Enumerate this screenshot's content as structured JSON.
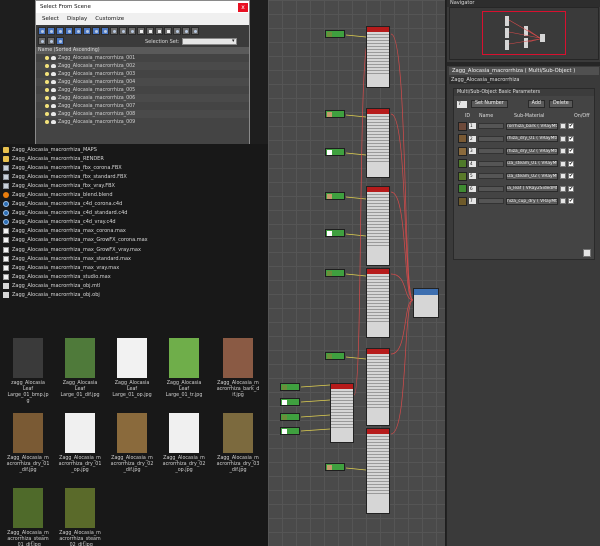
{
  "select_from_scene": {
    "title": "Select From Scene",
    "close_glyph": "x",
    "menus": [
      "Select",
      "Display",
      "Customize"
    ],
    "selection_set_label": "Selection Set:",
    "selection_set_value": "",
    "list_header": "Name (Sorted Ascending)",
    "objects": [
      "Zagg_Alocasia_macrorrhiza_001",
      "Zagg_Alocasia_macrorrhiza_002",
      "Zagg_Alocasia_macrorrhiza_003",
      "Zagg_Alocasia_macrorrhiza_004",
      "Zagg_Alocasia_macrorrhiza_005",
      "Zagg_Alocasia_macrorrhiza_006",
      "Zagg_Alocasia_macrorrhiza_007",
      "Zagg_Alocasia_macrorrhiza_008",
      "Zagg_Alocasia_macrorrhiza_009"
    ]
  },
  "files": [
    {
      "name": "Zagg_Alocasia_macrorrhiza_MAPS",
      "icon": "folder"
    },
    {
      "name": "Zagg_Alocasia_macrorrhiza_RENDER",
      "icon": "folder"
    },
    {
      "name": "Zagg_Alocasia_macrorrhiza_fbx_corona.FBX",
      "icon": "fbx"
    },
    {
      "name": "Zagg_Alocasia_macrorrhiza_fbx_standard.FBX",
      "icon": "fbx"
    },
    {
      "name": "Zagg_Alocasia_macrorrhiza_fbx_vray.FBX",
      "icon": "fbx"
    },
    {
      "name": "Zagg_Alocasia_macrorrhiza_blend.blend",
      "icon": "blend"
    },
    {
      "name": "Zagg_Alocasia_macrorrhiza_c4d_corona.c4d",
      "icon": "cfile"
    },
    {
      "name": "Zagg_Alocasia_macrorrhiza_c4d_standard.c4d",
      "icon": "cfile"
    },
    {
      "name": "Zagg_Alocasia_macrorrhiza_c4d_vray.c4d",
      "icon": "cfile"
    },
    {
      "name": "Zagg_Alocasia_macrorrhiza_max_corona.max",
      "icon": "max"
    },
    {
      "name": "Zagg_Alocasia_macrorrhiza_max_GrowFX_corona.max",
      "icon": "max"
    },
    {
      "name": "Zagg_Alocasia_macrorrhiza_max_GrowFX_vray.max",
      "icon": "max"
    },
    {
      "name": "Zagg_Alocasia_macrorrhiza_max_standard.max",
      "icon": "max"
    },
    {
      "name": "Zagg_Alocasia_macrorrhiza_max_vray.max",
      "icon": "max"
    },
    {
      "name": "Zagg_Alocasia_macrorrhiza_studio.max",
      "icon": "max"
    },
    {
      "name": "Zagg_Alocasia_macrorrhiza_obj.mtl",
      "icon": "mtl"
    },
    {
      "name": "Zagg_Alocasia_macrorrhiza_obj.obj",
      "icon": "mtl"
    }
  ],
  "thumbnails": [
    {
      "lines": [
        "zagg_Alocasia",
        "Leaf",
        "Large_01_bmp.jp",
        "g"
      ],
      "color": "#3a3a3a"
    },
    {
      "lines": [
        "Zagg_Alocasia",
        "Leaf",
        "Large_01_dif.jpg"
      ],
      "color": "#4f7a3a"
    },
    {
      "lines": [
        "Zagg_Alocasia",
        "Leaf",
        "Large_01_op.jpg"
      ],
      "color": "#f2f2f2"
    },
    {
      "lines": [
        "Zagg_Alocasia",
        "Leaf",
        "Large_01_tr.jpg"
      ],
      "color": "#6fae4a"
    },
    {
      "lines": [
        "Zagg_Alocasia_m",
        "acrorrhiza_bark_d",
        "if.jpg"
      ],
      "color": "#8a5a44"
    },
    {
      "lines": [
        "Zagg_Alocasia_m",
        "acrorrhiza_dry_01",
        "_dif.jpg"
      ],
      "color": "#7a5a34"
    },
    {
      "lines": [
        "Zagg_Alocasia_m",
        "acrorrhiza_dry_01",
        "_op.jpg"
      ],
      "color": "#f0f0f0"
    },
    {
      "lines": [
        "Zagg_Alocasia_m",
        "acrorrhiza_dry_02",
        "_dif.jpg"
      ],
      "color": "#8a6a3c"
    },
    {
      "lines": [
        "Zagg_Alocasia_m",
        "acrorrhiza_dry_02",
        "_op.jpg"
      ],
      "color": "#f0f0f0"
    },
    {
      "lines": [
        "Zagg_Alocasia_m",
        "acrorrhiza_dry_03",
        "_dif.jpg"
      ],
      "color": "#7c6a3e"
    },
    {
      "lines": [
        "Zagg_Alocasia_m",
        "acrorrhiza_steam",
        "_01_dif.jpg"
      ],
      "color": "#4f6a2a"
    },
    {
      "lines": [
        "Zagg_Alocasia_m",
        "acrorrhiza_steam",
        "_02_dif.jpg"
      ],
      "color": "#5a6a2a"
    }
  ],
  "navigator": {
    "title": "Navigator"
  },
  "material": {
    "title": "Zagg_Alocasia_macrorrhiza  ( Multi/Sub-Object )",
    "name": "Zagg_Alocasia_macrorrhiza",
    "rollout_title": "Multi/Sub-Object Basic Parameters",
    "count": "7",
    "set_number_label": "Set Number",
    "add_label": "Add",
    "delete_label": "Delete",
    "columns": [
      "ID",
      "Name",
      "Sub-Material",
      "On/Off"
    ],
    "slots": [
      {
        "id": "1",
        "sub": "rorrhiza_bark  ( VRayMtl )",
        "swatch": "#6e4a3a"
      },
      {
        "id": "2",
        "sub": "rhiza_dry_01  ( VRayMtl )",
        "swatch": "#7a5a34"
      },
      {
        "id": "3",
        "sub": "rhiza_dry_02  ( VRayMtl )",
        "swatch": "#8a6a3c"
      },
      {
        "id": "4",
        "sub": "iza_steam_01  ( VRayMtl )",
        "swatch": "#4f7a2a"
      },
      {
        "id": "5",
        "sub": "iza_steam_02  ( VRayMtl )",
        "swatch": "#5a7a2a"
      },
      {
        "id": "6",
        "sub": "ia_leaf  ( VRay2SidedMtl )",
        "swatch": "#3f8a32"
      },
      {
        "id": "7",
        "sub": "hiza_cup_dry  ( VRayMtl )",
        "swatch": "#6e5a2a"
      }
    ],
    "check_glyph": "✔"
  },
  "colors": {
    "node_header": "#b61b1b",
    "wire": "#d84b4b",
    "bitmap_node": "#3fa03f"
  }
}
